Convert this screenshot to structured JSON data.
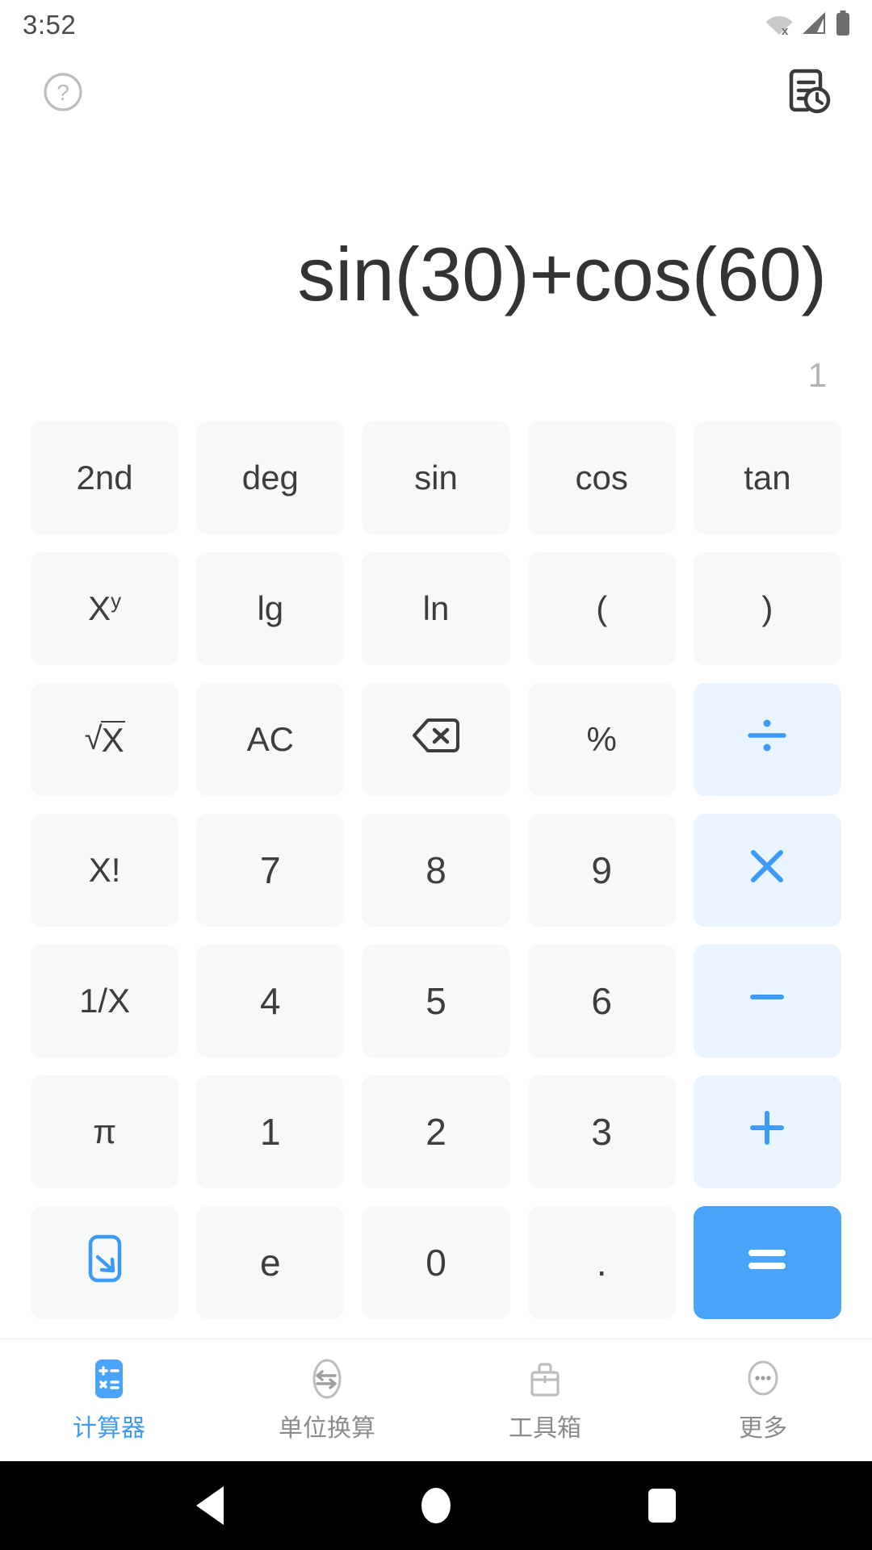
{
  "status_bar": {
    "time": "3:52",
    "icons": [
      "wifi-off-icon",
      "cellular-signal-icon",
      "battery-full-icon"
    ]
  },
  "app_bar": {
    "help_icon": "help-circle-icon",
    "history_icon": "history-document-clock-icon"
  },
  "display": {
    "expression": "sin(30)+cos(60)",
    "result": "1"
  },
  "colors": {
    "accent_blue": "#3d9bf7",
    "equals_blue": "#49a3f8",
    "operator_bg": "#eaf4fe",
    "key_bg": "#f7f8f8",
    "key_text": "#3d3d3d",
    "result_text": "#b5b5b5",
    "expression_text": "#333333"
  },
  "keypad": {
    "rows": [
      [
        {
          "label": "2nd",
          "name": "key-2nd",
          "type": "fn"
        },
        {
          "label": "deg",
          "name": "key-deg",
          "type": "fn"
        },
        {
          "label": "sin",
          "name": "key-sin",
          "type": "fn"
        },
        {
          "label": "cos",
          "name": "key-cos",
          "type": "fn"
        },
        {
          "label": "tan",
          "name": "key-tan",
          "type": "fn"
        }
      ],
      [
        {
          "label": "X",
          "sup": "y",
          "name": "key-power",
          "type": "fn"
        },
        {
          "label": "lg",
          "name": "key-lg",
          "type": "fn"
        },
        {
          "label": "ln",
          "name": "key-ln",
          "type": "fn"
        },
        {
          "label": "(",
          "name": "key-open-paren",
          "type": "fn"
        },
        {
          "label": ")",
          "name": "key-close-paren",
          "type": "fn"
        }
      ],
      [
        {
          "label": "√X",
          "name": "key-square-root",
          "type": "sqrt"
        },
        {
          "label": "AC",
          "name": "key-all-clear",
          "type": "fn"
        },
        {
          "label": "",
          "name": "key-backspace",
          "type": "icon",
          "icon": "backspace-icon"
        },
        {
          "label": "%",
          "name": "key-percent",
          "type": "fn"
        },
        {
          "label": "÷",
          "name": "key-divide",
          "type": "op",
          "icon": "divide-icon"
        }
      ],
      [
        {
          "label": "X!",
          "name": "key-factorial",
          "type": "fn"
        },
        {
          "label": "7",
          "name": "key-7",
          "type": "num"
        },
        {
          "label": "8",
          "name": "key-8",
          "type": "num"
        },
        {
          "label": "9",
          "name": "key-9",
          "type": "num"
        },
        {
          "label": "×",
          "name": "key-multiply",
          "type": "op",
          "icon": "multiply-icon"
        }
      ],
      [
        {
          "label": "1/X",
          "name": "key-reciprocal",
          "type": "fn"
        },
        {
          "label": "4",
          "name": "key-4",
          "type": "num"
        },
        {
          "label": "5",
          "name": "key-5",
          "type": "num"
        },
        {
          "label": "6",
          "name": "key-6",
          "type": "num"
        },
        {
          "label": "−",
          "name": "key-minus",
          "type": "op",
          "icon": "minus-icon"
        }
      ],
      [
        {
          "label": "π",
          "name": "key-pi",
          "type": "fn"
        },
        {
          "label": "1",
          "name": "key-1",
          "type": "num"
        },
        {
          "label": "2",
          "name": "key-2",
          "type": "num"
        },
        {
          "label": "3",
          "name": "key-3",
          "type": "num"
        },
        {
          "label": "+",
          "name": "key-plus",
          "type": "op",
          "icon": "plus-icon"
        }
      ],
      [
        {
          "label": "",
          "name": "key-collapse-keypad",
          "type": "icon",
          "icon": "collapse-arrow-icon"
        },
        {
          "label": "e",
          "name": "key-e",
          "type": "num"
        },
        {
          "label": "0",
          "name": "key-0",
          "type": "num"
        },
        {
          "label": ".",
          "name": "key-decimal-point",
          "type": "num"
        },
        {
          "label": "=",
          "name": "key-equals",
          "type": "equals",
          "icon": "equals-icon"
        }
      ]
    ]
  },
  "tab_bar": {
    "items": [
      {
        "label": "计算器",
        "name": "tab-calculator",
        "icon": "calculator-icon",
        "active": true
      },
      {
        "label": "单位换算",
        "name": "tab-unit-conversion",
        "icon": "unit-convert-icon",
        "active": false
      },
      {
        "label": "工具箱",
        "name": "tab-toolbox",
        "icon": "toolbox-icon",
        "active": false
      },
      {
        "label": "更多",
        "name": "tab-more",
        "icon": "more-dots-icon",
        "active": false
      }
    ]
  },
  "android_nav": {
    "back": "back-triangle-icon",
    "home": "home-circle-icon",
    "recents": "recents-square-icon"
  }
}
